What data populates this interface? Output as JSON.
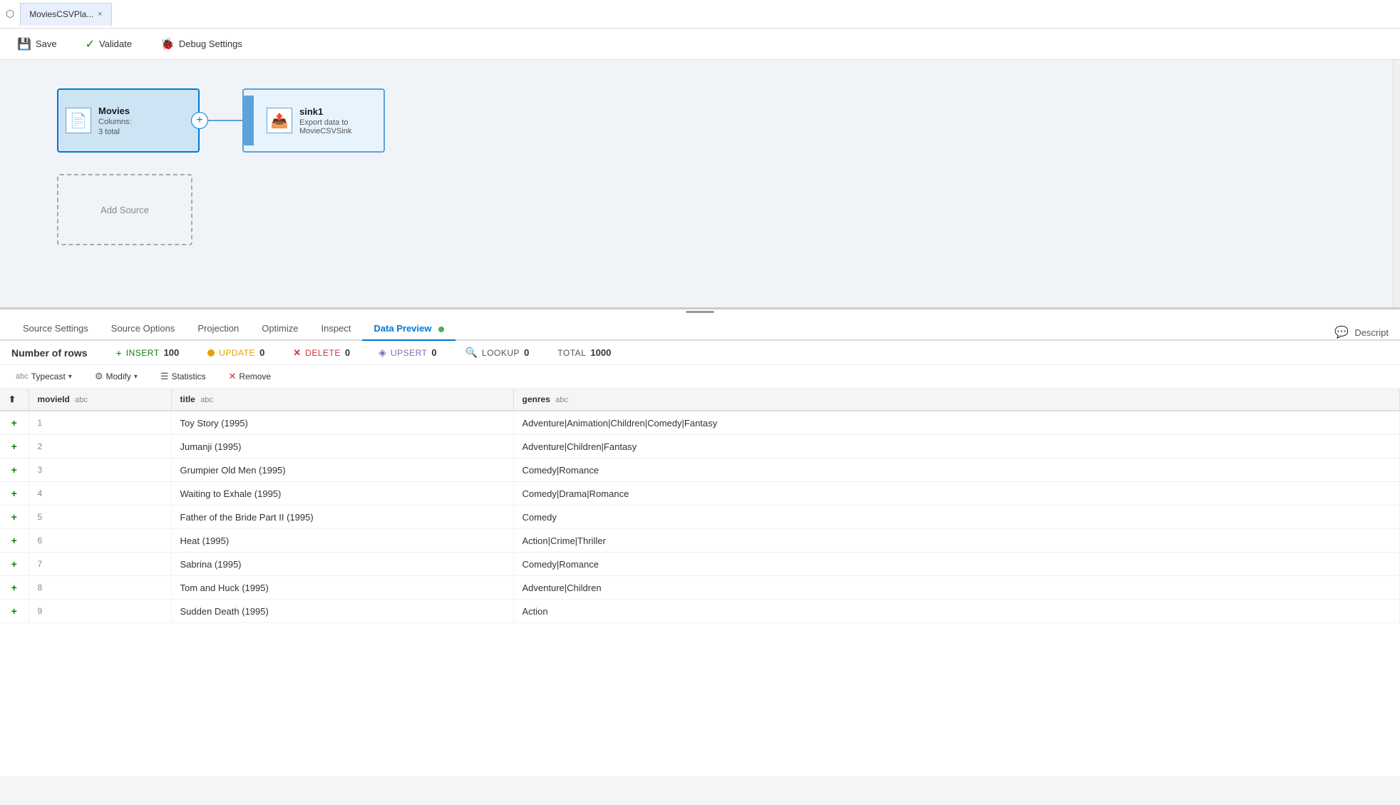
{
  "titlebar": {
    "tab_title": "MoviesCSVPla...",
    "close_label": "×"
  },
  "toolbar": {
    "save_label": "Save",
    "validate_label": "Validate",
    "debug_label": "Debug Settings"
  },
  "canvas": {
    "source_node": {
      "title": "Movies",
      "col_label": "Columns:",
      "col_value": "3 total"
    },
    "sink_node": {
      "title": "sink1",
      "description": "Export data to MovieCSVSink"
    },
    "add_source_label": "Add Source"
  },
  "tabs": [
    {
      "id": "source-settings",
      "label": "Source Settings",
      "active": false
    },
    {
      "id": "source-options",
      "label": "Source Options",
      "active": false
    },
    {
      "id": "projection",
      "label": "Projection",
      "active": false
    },
    {
      "id": "optimize",
      "label": "Optimize",
      "active": false
    },
    {
      "id": "inspect",
      "label": "Inspect",
      "active": false
    },
    {
      "id": "data-preview",
      "label": "Data Preview",
      "active": true
    }
  ],
  "tabs_right": {
    "label": "Descript"
  },
  "stats": {
    "num_rows_label": "Number of rows",
    "insert_label": "INSERT",
    "insert_value": "100",
    "update_label": "UPDATE",
    "update_value": "0",
    "delete_label": "DELETE",
    "delete_value": "0",
    "upsert_label": "UPSERT",
    "upsert_value": "0",
    "lookup_label": "LOOKUP",
    "lookup_value": "0",
    "total_label": "TOTAL",
    "total_value": "1000"
  },
  "data_toolbar": {
    "typecast_label": "Typecast",
    "modify_label": "Modify",
    "statistics_label": "Statistics",
    "remove_label": "Remove"
  },
  "table": {
    "columns": [
      {
        "key": "plus",
        "label": "⬆",
        "type": ""
      },
      {
        "key": "movieId",
        "label": "movieId",
        "type": "abc"
      },
      {
        "key": "title",
        "label": "title",
        "type": "abc"
      },
      {
        "key": "genres",
        "label": "genres",
        "type": "abc"
      }
    ],
    "rows": [
      {
        "plus": "+",
        "movieId": "1",
        "title": "Toy Story (1995)",
        "genres": "Adventure|Animation|Children|Comedy|Fantasy"
      },
      {
        "plus": "+",
        "movieId": "2",
        "title": "Jumanji (1995)",
        "genres": "Adventure|Children|Fantasy"
      },
      {
        "plus": "+",
        "movieId": "3",
        "title": "Grumpier Old Men (1995)",
        "genres": "Comedy|Romance"
      },
      {
        "plus": "+",
        "movieId": "4",
        "title": "Waiting to Exhale (1995)",
        "genres": "Comedy|Drama|Romance"
      },
      {
        "plus": "+",
        "movieId": "5",
        "title": "Father of the Bride Part II (1995)",
        "genres": "Comedy"
      },
      {
        "plus": "+",
        "movieId": "6",
        "title": "Heat (1995)",
        "genres": "Action|Crime|Thriller"
      },
      {
        "plus": "+",
        "movieId": "7",
        "title": "Sabrina (1995)",
        "genres": "Comedy|Romance"
      },
      {
        "plus": "+",
        "movieId": "8",
        "title": "Tom and Huck (1995)",
        "genres": "Adventure|Children"
      },
      {
        "plus": "+",
        "movieId": "9",
        "title": "Sudden Death (1995)",
        "genres": "Action"
      }
    ]
  }
}
